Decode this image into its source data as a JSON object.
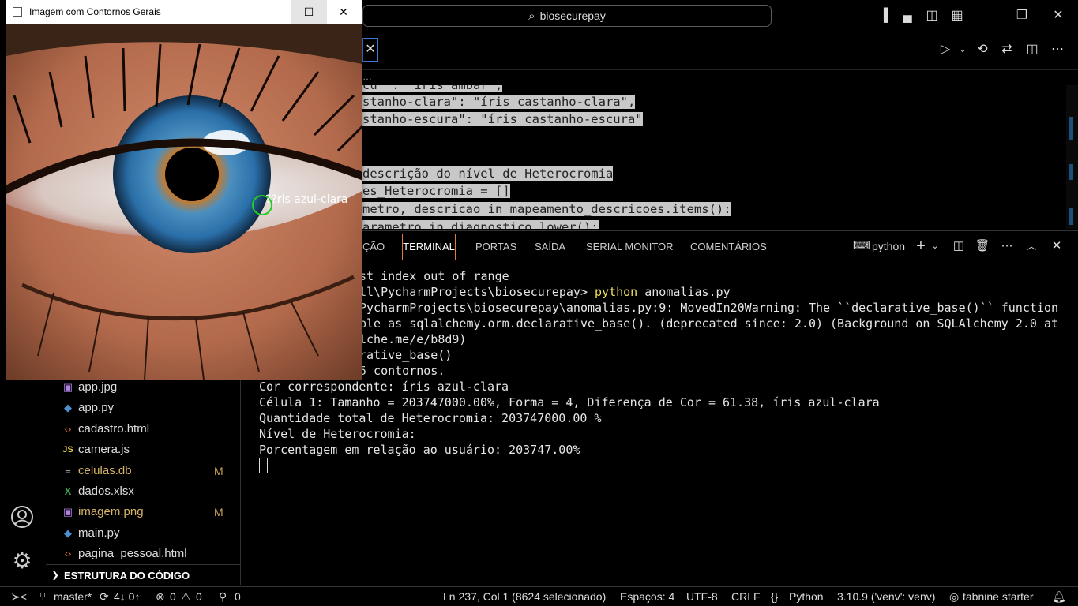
{
  "titlebar": {
    "search_text": "biosecurepay"
  },
  "breadcrumb": "…",
  "code_lines": [
    "cu\" : \"íris ambar\",",
    "stanho-clara\": \"íris castanho-clara\",",
    "stanho-escura\": \"íris castanho-escura\"",
    "",
    "",
    "descrição do nível de Heterocromia",
    "es_Heterocromia = []",
    "metro, descricao in mapeamento_descricoes.items():",
    "arametro in diagnostico.lower():"
  ],
  "panel": {
    "tabs": [
      "ÇÃO",
      "TERMINAL",
      "PORTAS",
      "SAÍDA",
      "SERIAL MONITOR",
      "COMENTÁRIOS"
    ],
    "shell_label": "python"
  },
  "terminal": {
    "lines": [
      "st index out of range",
      "ll\\PycharmProjects\\biosecurepay> ",
      "PycharmProjects\\biosecurepay\\anomalias.py:9: MovedIn20Warning: The ``declarative_base()`` function",
      "ble as sqlalchemy.orm.declarative_base(). (deprecated since: 2.0) (Background on SQLAlchemy 2.0 at",
      "lche.me/e/b8d9)",
      "rative_base()",
      "5 contornos.",
      "Cor correspondente: íris azul-clara",
      "Célula 1: Tamanho = 203747000.00%, Forma = 4, Diferença de Cor = 61.38, íris azul-clara",
      "Quantidade total de Heterocromia: 203747000.00 %",
      "Nível de Heterocromia:",
      "Porcentagem em relação ao usuário: 203747.00%"
    ],
    "command_word": "python",
    "command_arg": " anomalias.py"
  },
  "explorer": {
    "files": [
      {
        "name": "app.jpg",
        "icon": "image-icon",
        "badge": ""
      },
      {
        "name": "app.py",
        "icon": "python-icon",
        "badge": ""
      },
      {
        "name": "cadastro.html",
        "icon": "html-icon",
        "badge": ""
      },
      {
        "name": "camera.js",
        "icon": "js-icon",
        "badge": ""
      },
      {
        "name": "celulas.db",
        "icon": "db-icon",
        "badge": "M"
      },
      {
        "name": "dados.xlsx",
        "icon": "excel-icon",
        "badge": ""
      },
      {
        "name": "imagem.png",
        "icon": "image-icon",
        "badge": "M"
      },
      {
        "name": "main.py",
        "icon": "python-icon",
        "badge": ""
      },
      {
        "name": "pagina_pessoal.html",
        "icon": "html-icon",
        "badge": ""
      }
    ],
    "outline_label": "ESTRUTURA DO CÓDIGO"
  },
  "statusbar": {
    "branch": "master*",
    "sync": "4↓ 0↑",
    "errors": "0",
    "warnings": "0",
    "ports": "0",
    "position": "Ln 237, Col 1 (8624 selecionado)",
    "spaces": "Espaços: 4",
    "encoding": "UTF-8",
    "eol": "CRLF",
    "language": "Python",
    "interpreter": "3.10.9 ('venv': venv)",
    "tabnine": "tabnine starter"
  },
  "image_window": {
    "title": "Imagem com Contornos Gerais",
    "overlay_label": "??ris azul-clara"
  },
  "colors": {
    "accent_tab": "#e07a3a",
    "selection": "#c8c8c8",
    "contour": "#22cc22",
    "iris_blue": "#2a6fa8"
  }
}
